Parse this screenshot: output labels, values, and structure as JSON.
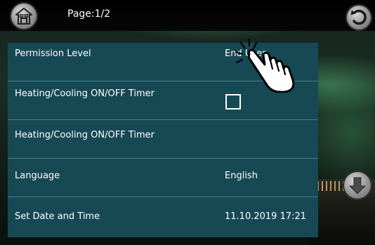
{
  "header": {
    "page_indicator": "Page:1/2",
    "home_icon": "home-icon",
    "back_icon": "back-arrow-icon"
  },
  "settings": {
    "rows": [
      {
        "label": "Permission Level",
        "value": "End User"
      },
      {
        "label": "Heating/Cooling ON/OFF Timer",
        "control": "checkbox",
        "checked": false
      },
      {
        "label": "Heating/Cooling ON/OFF Timer",
        "value": ""
      },
      {
        "label": "Language",
        "value": "English"
      },
      {
        "label": "Set Date and Time",
        "value": "11.10.2019 17:21"
      }
    ]
  },
  "navigation": {
    "scroll_down_icon": "arrow-down-icon"
  },
  "overlay": {
    "pointer_icon": "tap-hand-icon"
  },
  "colors": {
    "panel": "#174954",
    "divider": "#3f7f8c",
    "text": "#ffffff"
  }
}
